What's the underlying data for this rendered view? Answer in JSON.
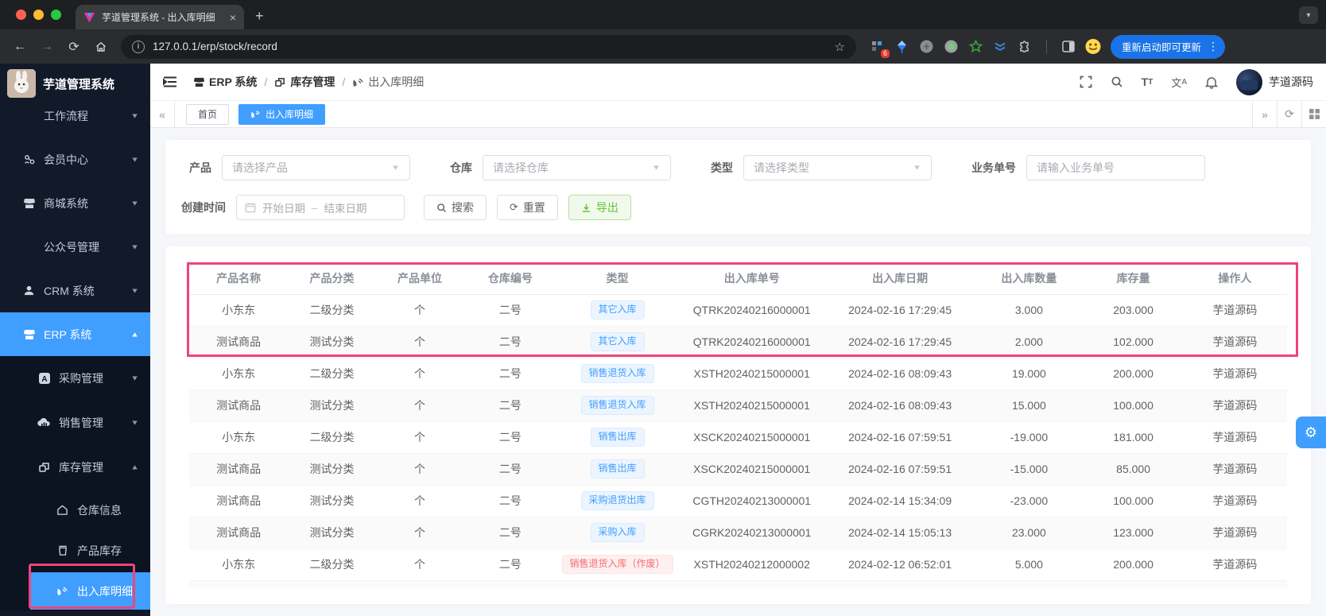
{
  "browser": {
    "tab_title": "芋道管理系统 - 出入库明细",
    "close_tab": "×",
    "new_tab": "+",
    "url": "127.0.0.1/erp/stock/record",
    "extension_badge": "6",
    "update_button": "重新启动即可更新"
  },
  "sidebar": {
    "title": "芋道管理系统",
    "items": [
      {
        "label": "工作流程"
      },
      {
        "label": "会员中心"
      },
      {
        "label": "商城系统"
      },
      {
        "label": "公众号管理"
      },
      {
        "label": "CRM 系统"
      },
      {
        "label": "ERP 系统"
      },
      {
        "label": "采购管理"
      },
      {
        "label": "销售管理"
      },
      {
        "label": "库存管理"
      },
      {
        "label": "仓库信息"
      },
      {
        "label": "产品库存"
      },
      {
        "label": "出入库明细"
      }
    ]
  },
  "navbar": {
    "breadcrumb": [
      {
        "label": "ERP 系统"
      },
      {
        "label": "库存管理"
      },
      {
        "label": "出入库明细"
      }
    ],
    "username": "芋道源码"
  },
  "tagsbar": {
    "tabs": [
      {
        "label": "首页"
      },
      {
        "label": "出入库明细"
      }
    ]
  },
  "filters": {
    "product": {
      "label": "产品",
      "placeholder": "请选择产品"
    },
    "warehouse": {
      "label": "仓库",
      "placeholder": "请选择仓库"
    },
    "type": {
      "label": "类型",
      "placeholder": "请选择类型"
    },
    "biz_no": {
      "label": "业务单号",
      "placeholder": "请输入业务单号"
    },
    "create_time": {
      "label": "创建时间",
      "start_placeholder": "开始日期",
      "separator": "–",
      "end_placeholder": "结束日期"
    },
    "search": "搜索",
    "reset": "重置",
    "export": "导出"
  },
  "table": {
    "columns": [
      "产品名称",
      "产品分类",
      "产品单位",
      "仓库编号",
      "类型",
      "出入库单号",
      "出入库日期",
      "出入库数量",
      "库存量",
      "操作人"
    ],
    "rows": [
      {
        "name": "小东东",
        "category": "二级分类",
        "unit": "个",
        "warehouse": "二号",
        "type": "其它入库",
        "type_style": "info",
        "order_no": "QTRK20240216000001",
        "datetime": "2024-02-16 17:29:45",
        "quantity": "3.000",
        "stock": "203.000",
        "operator": "芋道源码"
      },
      {
        "name": "测试商品",
        "category": "测试分类",
        "unit": "个",
        "warehouse": "二号",
        "type": "其它入库",
        "type_style": "info",
        "order_no": "QTRK20240216000001",
        "datetime": "2024-02-16 17:29:45",
        "quantity": "2.000",
        "stock": "102.000",
        "operator": "芋道源码"
      },
      {
        "name": "小东东",
        "category": "二级分类",
        "unit": "个",
        "warehouse": "二号",
        "type": "销售退货入库",
        "type_style": "info",
        "order_no": "XSTH20240215000001",
        "datetime": "2024-02-16 08:09:43",
        "quantity": "19.000",
        "stock": "200.000",
        "operator": "芋道源码"
      },
      {
        "name": "测试商品",
        "category": "测试分类",
        "unit": "个",
        "warehouse": "二号",
        "type": "销售退货入库",
        "type_style": "info",
        "order_no": "XSTH20240215000001",
        "datetime": "2024-02-16 08:09:43",
        "quantity": "15.000",
        "stock": "100.000",
        "operator": "芋道源码"
      },
      {
        "name": "小东东",
        "category": "二级分类",
        "unit": "个",
        "warehouse": "二号",
        "type": "销售出库",
        "type_style": "info",
        "order_no": "XSCK20240215000001",
        "datetime": "2024-02-16 07:59:51",
        "quantity": "-19.000",
        "stock": "181.000",
        "operator": "芋道源码"
      },
      {
        "name": "测试商品",
        "category": "测试分类",
        "unit": "个",
        "warehouse": "二号",
        "type": "销售出库",
        "type_style": "info",
        "order_no": "XSCK20240215000001",
        "datetime": "2024-02-16 07:59:51",
        "quantity": "-15.000",
        "stock": "85.000",
        "operator": "芋道源码"
      },
      {
        "name": "测试商品",
        "category": "测试分类",
        "unit": "个",
        "warehouse": "二号",
        "type": "采购退货出库",
        "type_style": "info",
        "order_no": "CGTH20240213000001",
        "datetime": "2024-02-14 15:34:09",
        "quantity": "-23.000",
        "stock": "100.000",
        "operator": "芋道源码"
      },
      {
        "name": "测试商品",
        "category": "测试分类",
        "unit": "个",
        "warehouse": "二号",
        "type": "采购入库",
        "type_style": "info",
        "order_no": "CGRK20240213000001",
        "datetime": "2024-02-14 15:05:13",
        "quantity": "23.000",
        "stock": "123.000",
        "operator": "芋道源码"
      },
      {
        "name": "小东东",
        "category": "二级分类",
        "unit": "个",
        "warehouse": "二号",
        "type": "销售退货入库（作废）",
        "type_style": "danger",
        "order_no": "XSTH20240212000002",
        "datetime": "2024-02-12 06:52:01",
        "quantity": "5.000",
        "stock": "200.000",
        "operator": "芋道源码"
      }
    ]
  },
  "colors": {
    "accent": "#409eff",
    "annotation": "#f0437d",
    "tag-info-text": "#409eff",
    "tag-info-bg": "#ecf5ff",
    "tag-info-border": "#d9ecff",
    "tag-danger-text": "#f56c6c",
    "tag-danger-bg": "#fef0f0",
    "tag-danger-border": "#fde2e2",
    "success": "#67c23a",
    "success-bg": "#f0f9eb",
    "success-border": "#b3e19d",
    "chrome-update": "#1a73e8"
  }
}
